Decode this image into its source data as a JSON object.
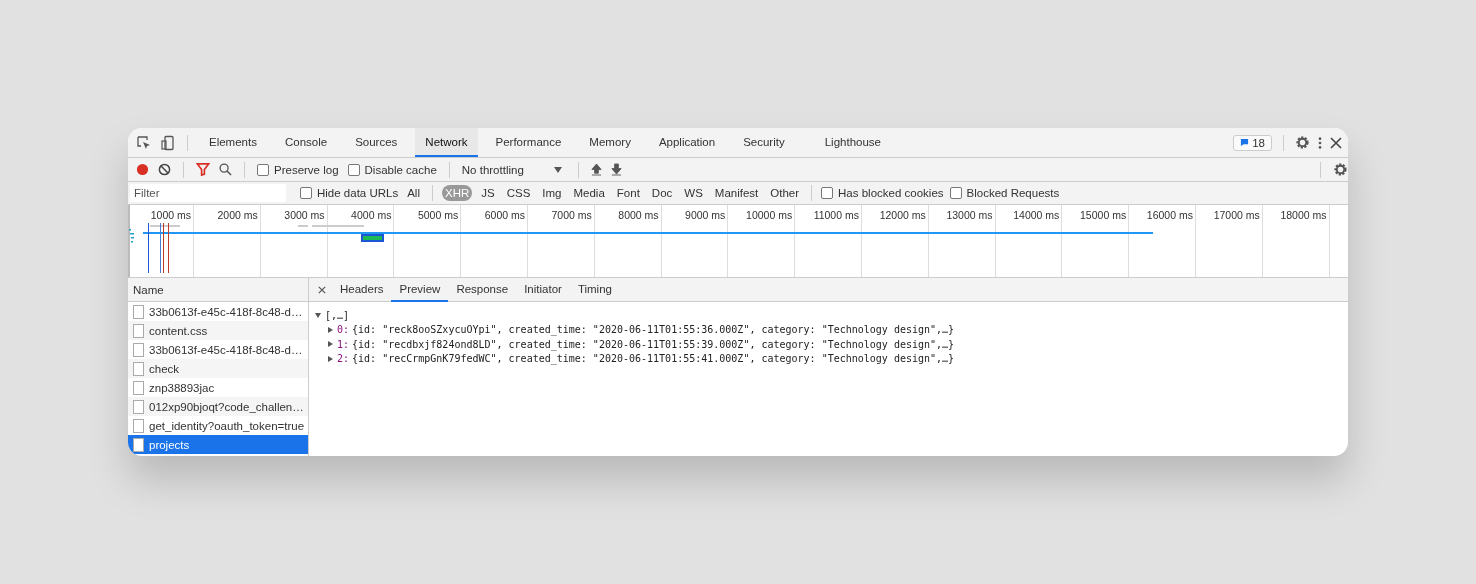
{
  "tabs": [
    {
      "label": "Elements",
      "selected": false
    },
    {
      "label": "Console",
      "selected": false
    },
    {
      "label": "Sources",
      "selected": false
    },
    {
      "label": "Network",
      "selected": true
    },
    {
      "label": "Performance",
      "selected": false
    },
    {
      "label": "Memory",
      "selected": false
    },
    {
      "label": "Application",
      "selected": false
    },
    {
      "label": "Security",
      "selected": false
    },
    {
      "label": "Lighthouse",
      "selected": false
    }
  ],
  "issues_badge": "18",
  "toolbar": {
    "recording": true,
    "preserve_log": {
      "label": "Preserve log",
      "checked": false
    },
    "disable_cache": {
      "label": "Disable cache",
      "checked": false
    },
    "throttling": "No throttling"
  },
  "filter_bar": {
    "placeholder": "Filter",
    "hide_data_urls": {
      "label": "Hide data URLs",
      "checked": false
    },
    "types": [
      {
        "label": "All",
        "selected": false
      },
      {
        "label": "XHR",
        "selected": true
      },
      {
        "label": "JS",
        "selected": false
      },
      {
        "label": "CSS",
        "selected": false
      },
      {
        "label": "Img",
        "selected": false
      },
      {
        "label": "Media",
        "selected": false
      },
      {
        "label": "Font",
        "selected": false
      },
      {
        "label": "Doc",
        "selected": false
      },
      {
        "label": "WS",
        "selected": false
      },
      {
        "label": "Manifest",
        "selected": false
      },
      {
        "label": "Other",
        "selected": false
      }
    ],
    "has_blocked_cookies": {
      "label": "Has blocked cookies",
      "checked": false
    },
    "blocked_requests": {
      "label": "Blocked Requests",
      "checked": false
    }
  },
  "timeline": {
    "ticks": [
      "1000 ms",
      "2000 ms",
      "3000 ms",
      "4000 ms",
      "5000 ms",
      "6000 ms",
      "7000 ms",
      "8000 ms",
      "9000 ms",
      "10000 ms",
      "11000 ms",
      "12000 ms",
      "13000 ms",
      "14000 ms",
      "15000 ms",
      "16000 ms",
      "17000 ms",
      "18000 ms"
    ]
  },
  "requests": {
    "header": "Name",
    "rows": [
      {
        "name": "33b0613f-e45c-418f-8c48-d…",
        "selected": false
      },
      {
        "name": "content.css",
        "selected": false
      },
      {
        "name": "33b0613f-e45c-418f-8c48-d…",
        "selected": false
      },
      {
        "name": "check",
        "selected": false
      },
      {
        "name": "znp38893jac",
        "selected": false
      },
      {
        "name": "012xp90bjoqt?code_challen…",
        "selected": false
      },
      {
        "name": "get_identity?oauth_token=true",
        "selected": false
      },
      {
        "name": "projects",
        "selected": true
      }
    ]
  },
  "detail_tabs": [
    {
      "label": "Headers",
      "selected": false
    },
    {
      "label": "Preview",
      "selected": true
    },
    {
      "label": "Response",
      "selected": false
    },
    {
      "label": "Initiator",
      "selected": false
    },
    {
      "label": "Timing",
      "selected": false
    }
  ],
  "preview": {
    "root": "[,…]",
    "expanded": true,
    "items": [
      {
        "index": "0:",
        "text": "{id: \"reck8ooSZxycuOYpi\", created_time: \"2020-06-11T01:55:36.000Z\", category: \"Technology design\",…}",
        "expanded": false
      },
      {
        "index": "1:",
        "text": "{id: \"recdbxjf824ond8LD\", created_time: \"2020-06-11T01:55:39.000Z\", category: \"Technology design\",…}",
        "expanded": false
      },
      {
        "index": "2:",
        "text": "{id: \"recCrmpGnK79fedWC\", created_time: \"2020-06-11T01:55:41.000Z\", category: \"Technology design\",…}",
        "expanded": false
      }
    ]
  }
}
